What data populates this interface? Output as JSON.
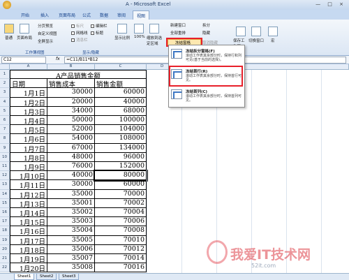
{
  "window": {
    "title": "A - Microsoft Excel",
    "controls": "— □ ×"
  },
  "tabs": [
    "开始",
    "插入",
    "页面布局",
    "公式",
    "数据",
    "审阅",
    "视图"
  ],
  "active_tab": "视图",
  "ribbon": {
    "normal": "普通",
    "page_layout": "页面布局",
    "page_break_preview": "分页预览",
    "custom_views": "自定义视图",
    "full_screen": "全屏显示",
    "ruler": "标尺",
    "gridlines": "网格线",
    "message_bar": "消息栏",
    "edit_bar": "编辑栏",
    "headings": "标题",
    "zoom": "显示比例",
    "zoom_100": "100%",
    "zoom_selection": "缩放到选定区域",
    "new_window": "新建窗口",
    "arrange_all": "全部重排",
    "freeze_panes": "冻结窗格",
    "split": "拆分",
    "hide": "隐藏",
    "unhide": "取消隐藏",
    "save_workspace": "保存工作区",
    "switch_windows": "切换窗口",
    "macros": "宏",
    "group_workbook_views": "工作簿视图",
    "group_show_hide": "显示/隐藏",
    "group_window": "窗口"
  },
  "formula_bar": {
    "name_box": "C12",
    "fx": "fx",
    "formula": "=C11/B11*B12"
  },
  "columns": [
    "A",
    "B",
    "C",
    "D"
  ],
  "sheet": {
    "title": "A产品销售金额",
    "headers": [
      "日期",
      "销售成本",
      "销售金额"
    ],
    "rows": [
      [
        "1月1日",
        "30000",
        "60000"
      ],
      [
        "1月2日",
        "20000",
        "40000"
      ],
      [
        "1月3日",
        "34000",
        "68000"
      ],
      [
        "1月4日",
        "50000",
        "100000"
      ],
      [
        "1月5日",
        "52000",
        "104000"
      ],
      [
        "1月6日",
        "54000",
        "108000"
      ],
      [
        "1月7日",
        "67000",
        "134000"
      ],
      [
        "1月8日",
        "48000",
        "96000"
      ],
      [
        "1月9日",
        "76000",
        "152000"
      ],
      [
        "1月10日",
        "40000",
        "80000"
      ],
      [
        "1月11日",
        "30000",
        "60000"
      ],
      [
        "1月12日",
        "35000",
        "70000"
      ],
      [
        "1月13日",
        "35001",
        "70002"
      ],
      [
        "1月14日",
        "35002",
        "70004"
      ],
      [
        "1月15日",
        "35003",
        "70006"
      ],
      [
        "1月16日",
        "35004",
        "70008"
      ],
      [
        "1月17日",
        "35005",
        "70010"
      ],
      [
        "1月18日",
        "35006",
        "70012"
      ],
      [
        "1月19日",
        "35007",
        "70014"
      ],
      [
        "1月20日",
        "35008",
        "70016"
      ]
    ]
  },
  "row_numbers": [
    "1",
    "2",
    "3",
    "4",
    "5",
    "6",
    "7",
    "8",
    "9",
    "10",
    "11",
    "12",
    "13",
    "14",
    "15",
    "16",
    "17",
    "18",
    "19",
    "20",
    "21",
    "22"
  ],
  "menu": {
    "items": [
      {
        "title": "冻结拆分窗格(F)",
        "desc": "滚动工作表其余部分时，保持行和列可见(基于当前的选择)。"
      },
      {
        "title": "冻结首行(R)",
        "desc": "滚动工作表其余部分时，保持首行可见。"
      },
      {
        "title": "冻结首列(C)",
        "desc": "滚动工作表其余部分时，保持首列可见。"
      }
    ]
  },
  "sheet_tabs": [
    "Sheet1",
    "Sheet2",
    "Sheet3"
  ],
  "watermark": {
    "main": "我爱IT技术网",
    "sub": "52it.com"
  },
  "colors": {
    "highlight": "#e8202a",
    "ribbon": "#dbe6f4",
    "header": "#e4ecf7"
  }
}
